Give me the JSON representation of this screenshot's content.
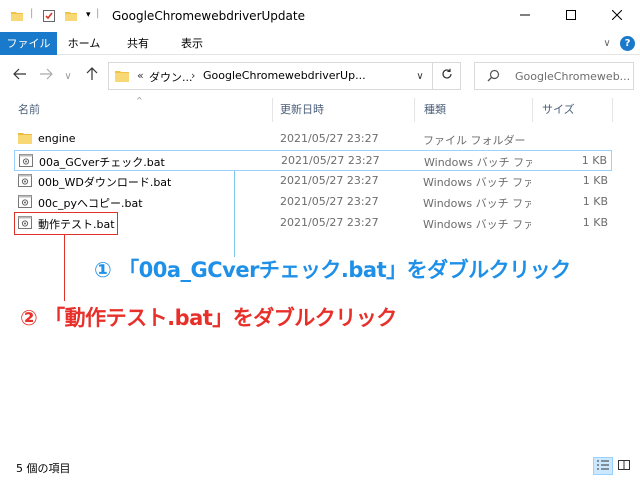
{
  "window": {
    "title": "GoogleChromewebdriverUpdate",
    "minimize_icon": "minimize-icon",
    "maximize_icon": "maximize-icon",
    "close_icon": "close-icon"
  },
  "ribbon": {
    "tabs": [
      {
        "label": "ファイル"
      },
      {
        "label": "ホーム"
      },
      {
        "label": "共有"
      },
      {
        "label": "表示"
      }
    ],
    "accent": "#1979ca",
    "help_label": "?"
  },
  "address": {
    "prefix": "«",
    "parent": "ダウン...",
    "separator": "›",
    "current": "GoogleChromewebdriverUp..."
  },
  "search": {
    "placeholder": "GoogleChromeweb..."
  },
  "columns": {
    "name": "名前",
    "date": "更新日時",
    "type": "種類",
    "size": "サイズ"
  },
  "files": [
    {
      "name": "engine",
      "date": "2021/05/27 23:27",
      "type": "ファイル フォルダー",
      "size": "",
      "icon": "folder-icon"
    },
    {
      "name": "00a_GCverチェック.bat",
      "date": "2021/05/27 23:27",
      "type": "Windows バッチ ファ...",
      "size": "1 KB",
      "icon": "batch-file-icon"
    },
    {
      "name": "00b_WDダウンロード.bat",
      "date": "2021/05/27 23:27",
      "type": "Windows バッチ ファ...",
      "size": "1 KB",
      "icon": "batch-file-icon"
    },
    {
      "name": "00c_pyへコピー.bat",
      "date": "2021/05/27 23:27",
      "type": "Windows バッチ ファ...",
      "size": "1 KB",
      "icon": "batch-file-icon"
    },
    {
      "name": "動作テスト.bat",
      "date": "2021/05/27 23:27",
      "type": "Windows バッチ ファ...",
      "size": "1 KB",
      "icon": "batch-file-icon"
    }
  ],
  "annotations": {
    "step1": "① 「00a_GCverチェック.bat」をダブルクリック",
    "step2": "② 「動作テスト.bat」をダブルクリック",
    "step1_color": "#1e90e8",
    "step2_color": "#e8302a"
  },
  "status": {
    "item_count": "5 個の項目"
  }
}
